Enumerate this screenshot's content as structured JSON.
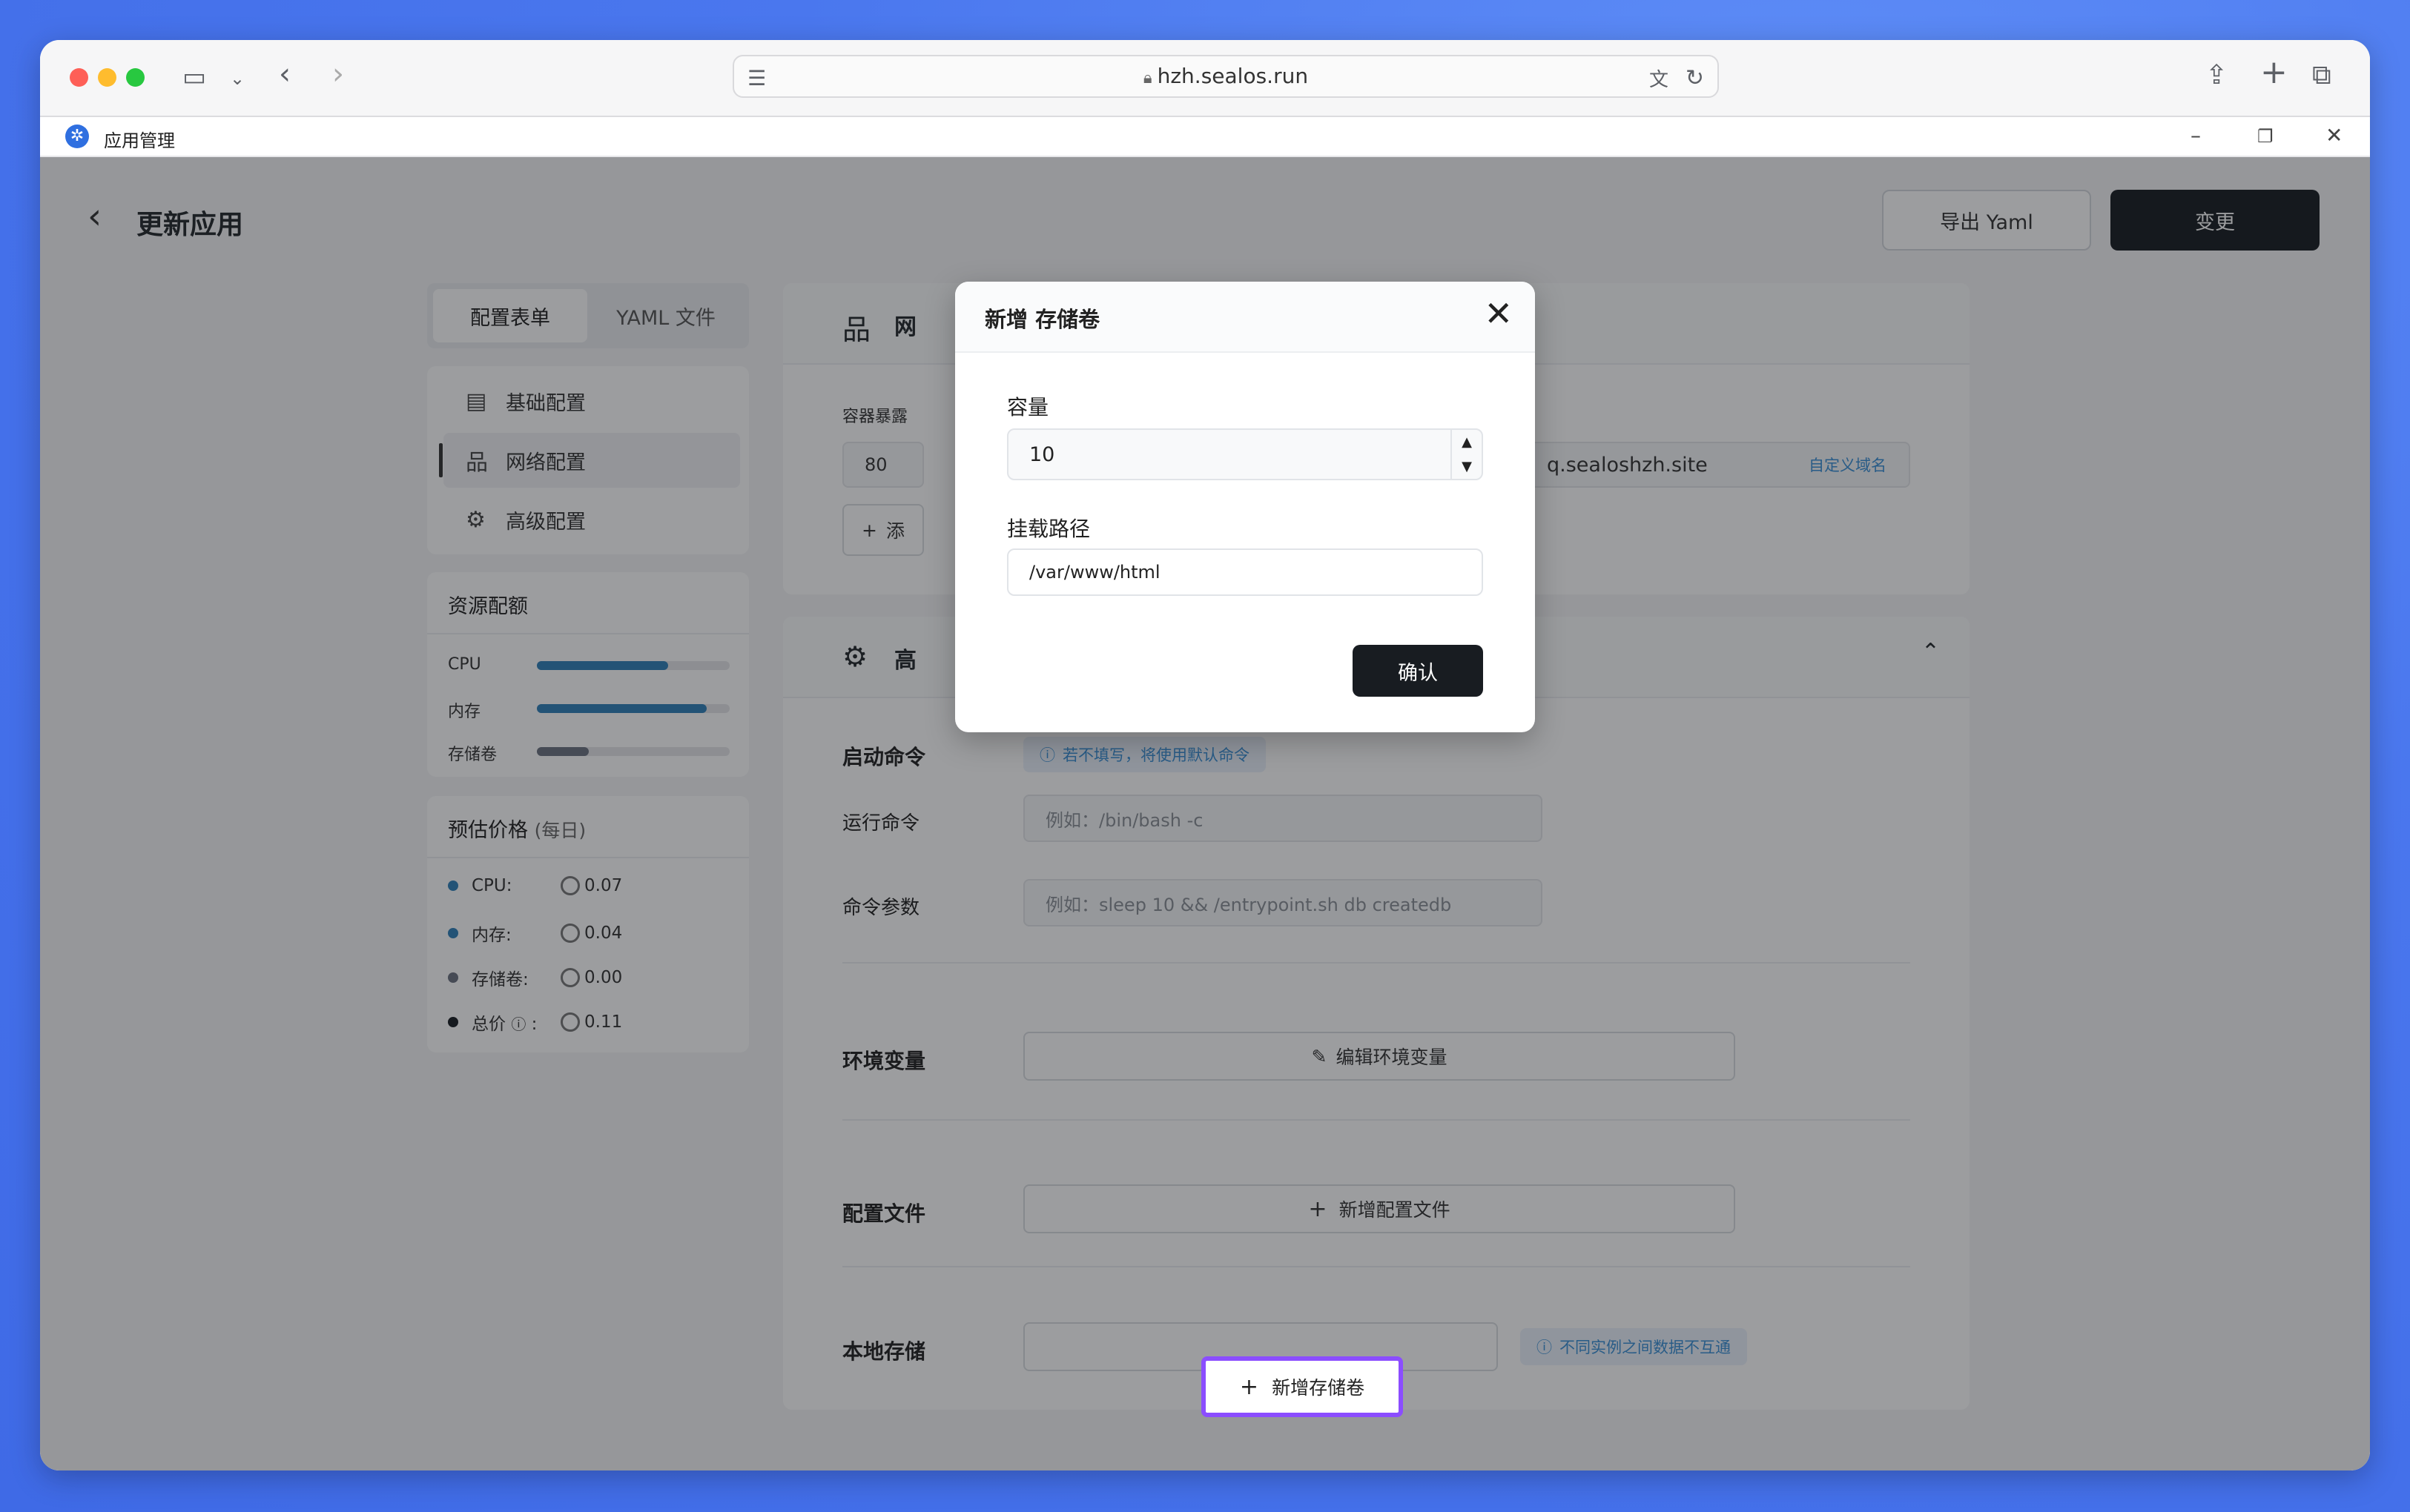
{
  "browser": {
    "url": "hzh.sealos.run"
  },
  "app": {
    "title": "应用管理"
  },
  "header": {
    "title": "更新应用",
    "export_label": "导出 Yaml",
    "change_label": "变更"
  },
  "tabs": [
    {
      "label": "配置表单"
    },
    {
      "label": "YAML 文件"
    }
  ],
  "nav": [
    {
      "label": "基础配置",
      "icon": "document-icon"
    },
    {
      "label": "网络配置",
      "icon": "network-icon"
    },
    {
      "label": "高级配置",
      "icon": "gear-icon"
    }
  ],
  "resources": {
    "title": "资源配额",
    "items": [
      {
        "label": "CPU",
        "level": 0.68,
        "color": "#2f80b8"
      },
      {
        "label": "内存",
        "level": 0.88,
        "color": "#2f80b8"
      },
      {
        "label": "存储卷",
        "level": 0.27,
        "color": "#6b7280"
      }
    ]
  },
  "price": {
    "title": "预估价格",
    "subtitle": "(每日)",
    "items": [
      {
        "label": "CPU:",
        "value": "0.07",
        "color": "#2f80b8"
      },
      {
        "label": "内存:",
        "value": "0.04",
        "color": "#2f80b8"
      },
      {
        "label": "存储卷:",
        "value": "0.00",
        "color": "#6b7280"
      },
      {
        "label": "总价",
        "value": "0.11",
        "color": "#181c21"
      }
    ]
  },
  "network": {
    "section_prefix": "网",
    "port_label": "容器暴露",
    "port_value": "80",
    "add_prefix": "添",
    "domain_suffix": "q.sealoshzh.site",
    "custom_domain": "自定义域名"
  },
  "advanced": {
    "section_prefix": "高",
    "start_cmd_label": "启动命令",
    "start_cmd_tip": "若不填写，将使用默认命令",
    "run_cmd_label": "运行命令",
    "run_cmd_placeholder": "例如：/bin/bash -c",
    "args_label": "命令参数",
    "args_placeholder": "例如：sleep 10 && /entrypoint.sh db createdb",
    "env_label": "环境变量",
    "env_button": "编辑环境变量",
    "config_label": "配置文件",
    "config_button": "新增配置文件",
    "storage_label": "本地存储",
    "storage_button": "新增存储卷",
    "storage_tip": "不同实例之间数据不互通"
  },
  "modal": {
    "title": "新增 存储卷",
    "capacity_label": "容量",
    "capacity_value": "10",
    "path_label": "挂载路径",
    "path_value": "/var/www/html",
    "confirm_label": "确认"
  }
}
